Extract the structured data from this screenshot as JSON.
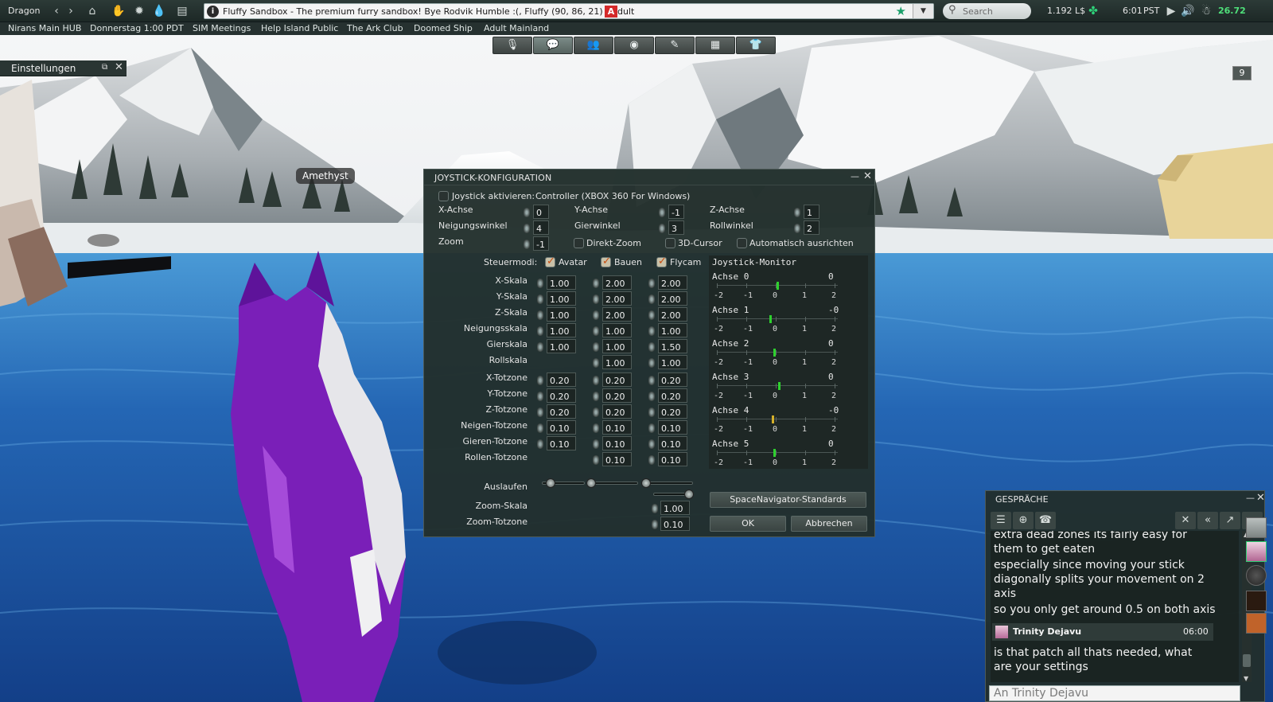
{
  "menubar": {
    "avatar_name": "Dragon",
    "location": "Fluffy Sandbox - The premium furry sandbox! Bye Rodvik Humble :(, Fluffy (90, 86, 21) - Adult",
    "adult_badge": "A",
    "search_placeholder": "Search",
    "balance": "1.192 L$",
    "time": "6:01",
    "timezone": "PST",
    "fps": "26.72"
  },
  "favorites": [
    "Nirans Main HUB",
    "Donnerstag 1:00 PDT",
    "SIM Meetings",
    "Help Island Public",
    "The Ark Club",
    "Doomed Ship",
    "Adult Mainland"
  ],
  "settings_floater": {
    "title": "Einstellungen"
  },
  "hud_count": "9",
  "nametag": "Amethyst",
  "joystick": {
    "title": "JOYSTICK-KONFIGURATION",
    "enable_label": "Joystick aktivieren:",
    "controller": "Controller (XBOX 360 For Windows)",
    "axis_map": [
      {
        "label": "X-Achse",
        "value": "0"
      },
      {
        "label": "Y-Achse",
        "value": "-1"
      },
      {
        "label": "Z-Achse",
        "value": "1"
      },
      {
        "label": "Neigungswinkel",
        "value": "4"
      },
      {
        "label": "Gierwinkel",
        "value": "3"
      },
      {
        "label": "Rollwinkel",
        "value": "2"
      },
      {
        "label": "Zoom",
        "value": "-1"
      }
    ],
    "options": [
      "Direkt-Zoom",
      "3D-Cursor",
      "Automatisch ausrichten"
    ],
    "modes_label": "Steuermodi:",
    "modes": [
      "Avatar",
      "Bauen",
      "Flycam"
    ],
    "scale_rows": [
      {
        "label": "X-Skala",
        "avatar": "1.00",
        "build": "2.00",
        "flycam": "2.00"
      },
      {
        "label": "Y-Skala",
        "avatar": "1.00",
        "build": "2.00",
        "flycam": "2.00"
      },
      {
        "label": "Z-Skala",
        "avatar": "1.00",
        "build": "2.00",
        "flycam": "2.00"
      },
      {
        "label": "Neigungsskala",
        "avatar": "1.00",
        "build": "1.00",
        "flycam": "1.00"
      },
      {
        "label": "Gierskala",
        "avatar": "1.00",
        "build": "1.00",
        "flycam": "1.50"
      },
      {
        "label": "Rollskala",
        "avatar": "",
        "build": "1.00",
        "flycam": "1.00"
      }
    ],
    "deadzone_rows": [
      {
        "label": "X-Totzone",
        "avatar": "0.20",
        "build": "0.20",
        "flycam": "0.20"
      },
      {
        "label": "Y-Totzone",
        "avatar": "0.20",
        "build": "0.20",
        "flycam": "0.20"
      },
      {
        "label": "Z-Totzone",
        "avatar": "0.20",
        "build": "0.20",
        "flycam": "0.20"
      },
      {
        "label": "Neigen-Totzone",
        "avatar": "0.10",
        "build": "0.10",
        "flycam": "0.10"
      },
      {
        "label": "Gieren-Totzone",
        "avatar": "0.10",
        "build": "0.10",
        "flycam": "0.10"
      },
      {
        "label": "Rollen-Totzone",
        "avatar": "",
        "build": "0.10",
        "flycam": "0.10"
      }
    ],
    "feathering_label": "Auslaufen",
    "zoom_scale_label": "Zoom-Skala",
    "zoom_scale": "1.00",
    "zoom_dead_label": "Zoom-Totzone",
    "zoom_dead": "0.10",
    "monitor_title": "Joystick-Monitor",
    "monitor_axes": [
      {
        "name": "Achse 0",
        "value": "0",
        "position": 0.05,
        "color": "#2ed12e"
      },
      {
        "name": "Achse 1",
        "value": "-0",
        "position": -0.2,
        "color": "#2ed12e"
      },
      {
        "name": "Achse 2",
        "value": "0",
        "position": -0.05,
        "color": "#2ed12e"
      },
      {
        "name": "Achse 3",
        "value": "0",
        "position": 0.1,
        "color": "#2ed12e"
      },
      {
        "name": "Achse 4",
        "value": "-0",
        "position": -0.12,
        "color": "#d4b02a"
      },
      {
        "name": "Achse 5",
        "value": "0",
        "position": -0.05,
        "color": "#2ed12e"
      }
    ],
    "tick_labels": [
      "-2",
      "-1",
      "0",
      "1",
      "2"
    ],
    "spacenav_button": "SpaceNavigator-Standards",
    "ok_button": "OK",
    "cancel_button": "Abbrechen"
  },
  "chat": {
    "title": "GESPRÄCHE",
    "messages": [
      "extra dead zones its fairly easy for",
      "them to get eaten",
      "especially since moving your stick",
      "diagonally splits your movement on 2",
      "axis",
      "so you only get around 0.5 on both axis"
    ],
    "sender": "Trinity Dejavu",
    "sender_time": "06:00",
    "last_messages": [
      "is that patch all thats needed, what",
      "are your settings"
    ],
    "input_placeholder": "An Trinity Dejavu"
  }
}
